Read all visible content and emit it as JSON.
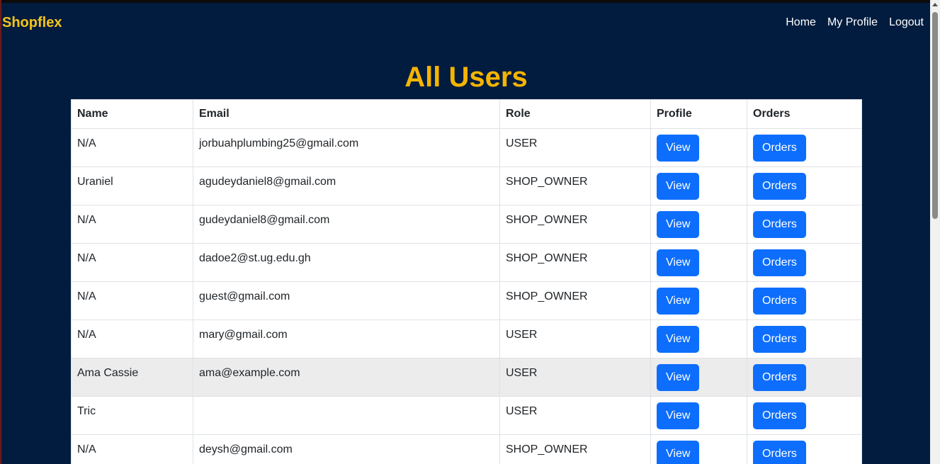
{
  "navbar": {
    "brand": "Shopflex",
    "links": [
      "Home",
      "My Profile",
      "Logout"
    ]
  },
  "page": {
    "title": "All Users"
  },
  "table": {
    "headers": [
      "Name",
      "Email",
      "Role",
      "Profile",
      "Orders"
    ],
    "view_label": "View",
    "orders_label": "Orders",
    "rows": [
      {
        "name": "N/A",
        "email": "jorbuahplumbing25@gmail.com",
        "role": "USER"
      },
      {
        "name": "Uraniel",
        "email": "agudeydaniel8@gmail.com",
        "role": "SHOP_OWNER"
      },
      {
        "name": "N/A",
        "email": "gudeydaniel8@gmail.com",
        "role": "SHOP_OWNER"
      },
      {
        "name": "N/A",
        "email": "dadoe2@st.ug.edu.gh",
        "role": "SHOP_OWNER"
      },
      {
        "name": "N/A",
        "email": "guest@gmail.com",
        "role": "SHOP_OWNER"
      },
      {
        "name": "N/A",
        "email": "mary@gmail.com",
        "role": "USER"
      },
      {
        "name": "Ama Cassie",
        "email": "ama@example.com",
        "role": "USER"
      },
      {
        "name": "Tric",
        "email": "",
        "role": "USER"
      },
      {
        "name": "N/A",
        "email": "deysh@gmail.com",
        "role": "SHOP_OWNER"
      }
    ]
  },
  "colors": {
    "background": "#021c3f",
    "brand": "#f5c518",
    "title": "#f5b400",
    "button": "#0d6efd",
    "highlight_row": "#ececec"
  }
}
